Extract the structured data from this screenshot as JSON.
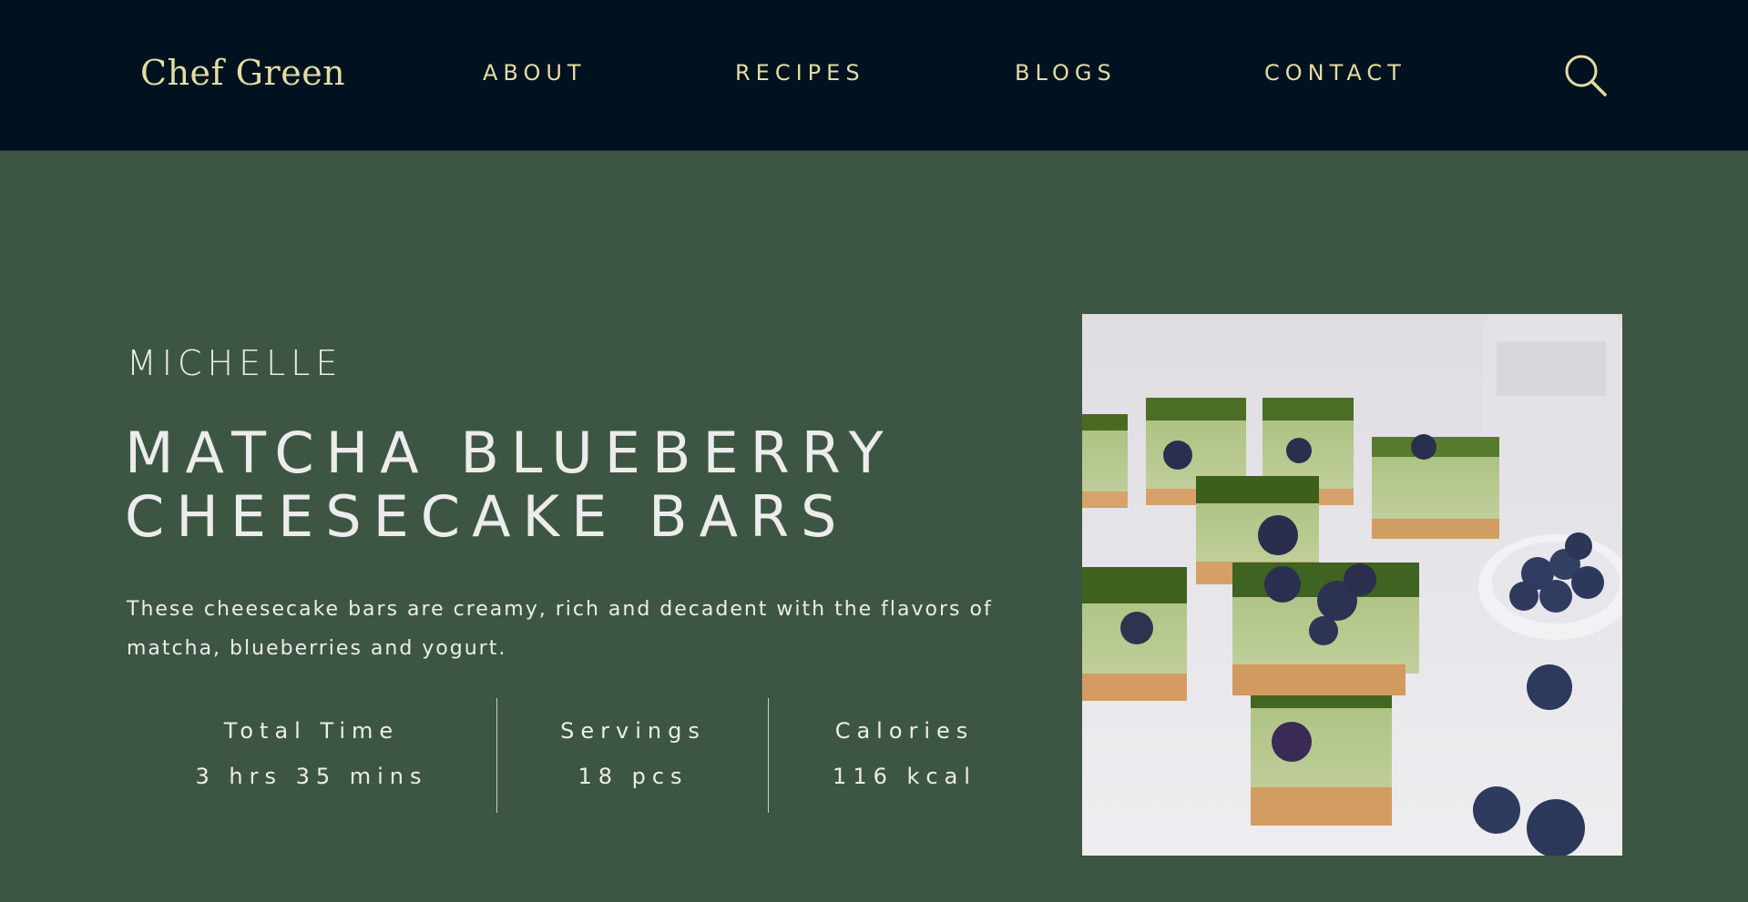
{
  "brand": "Chef Green",
  "nav": {
    "items": [
      "ABOUT",
      "RECIPES",
      "BLOGS",
      "CONTACT"
    ]
  },
  "icons": {
    "search": "search-icon"
  },
  "colors": {
    "topbar": "#001220",
    "nav_text": "#e4dca2",
    "background": "#3d5643",
    "text": "#ececec"
  },
  "recipe": {
    "author": "MICHELLE",
    "title_line1": "MATCHA BLUEBERRY",
    "title_line2": "CHEESECAKE BARS",
    "description": "These cheesecake bars are creamy, rich and decadent with the flavors of matcha, blueberries and yogurt.",
    "stats": [
      {
        "label": "Total Time",
        "value": "3 hrs 35 mins"
      },
      {
        "label": "Servings",
        "value": "18 pcs"
      },
      {
        "label": "Calories",
        "value": "116 kcal"
      }
    ]
  }
}
